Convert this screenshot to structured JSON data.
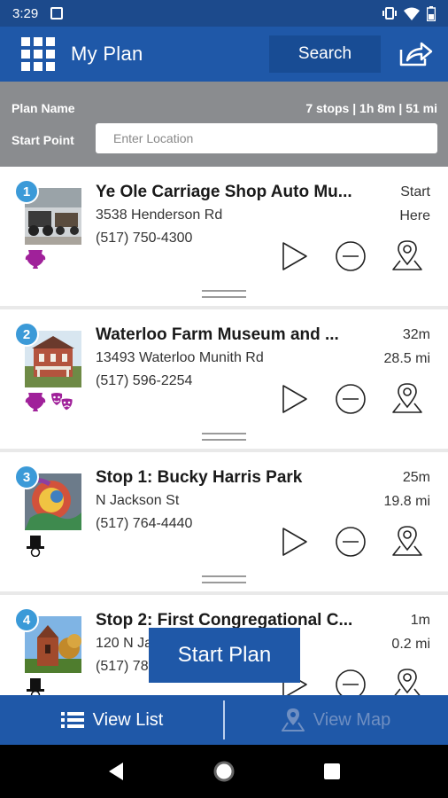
{
  "status_bar": {
    "time": "3:29"
  },
  "header": {
    "title": "My Plan",
    "search_label": "Search"
  },
  "plan": {
    "name_label": "Plan Name",
    "summary": "7 stops | 1h 8m | 51 mi",
    "start_point_label": "Start Point",
    "start_point_placeholder": "Enter Location",
    "start_point_value": ""
  },
  "stops": [
    {
      "number": "1",
      "title": "Ye Ole Carriage Shop Auto Mu...",
      "address": "3538 Henderson Rd",
      "phone": "(517) 750-4300",
      "time": "Start",
      "distance": "Here",
      "categories": [
        "museum-icon"
      ]
    },
    {
      "number": "2",
      "title": "Waterloo Farm Museum and ...",
      "address": "13493 Waterloo Munith Rd",
      "phone": "(517) 596-2254",
      "time": "32m",
      "distance": "28.5 mi",
      "categories": [
        "museum-icon",
        "theater-masks-icon"
      ]
    },
    {
      "number": "3",
      "title": "Stop 1: Bucky Harris Park",
      "address": "N Jackson St",
      "phone": "(517) 764-4440",
      "time": "25m",
      "distance": "19.8 mi",
      "categories": [
        "top-hat-icon"
      ]
    },
    {
      "number": "4",
      "title": "Stop 2: First Congregational C...",
      "address": "120 N Ja",
      "phone": "(517) 78",
      "time": "1m",
      "distance": "0.2 mi",
      "categories": [
        "top-hat-icon"
      ]
    }
  ],
  "start_plan_label": "Start Plan",
  "tabs": {
    "list_label": "View List",
    "map_label": "View Map"
  },
  "colors": {
    "primary": "#1f58a8",
    "badge": "#3b9ad8",
    "category": "#a0219a",
    "plan_bar": "#8a8c8f"
  }
}
